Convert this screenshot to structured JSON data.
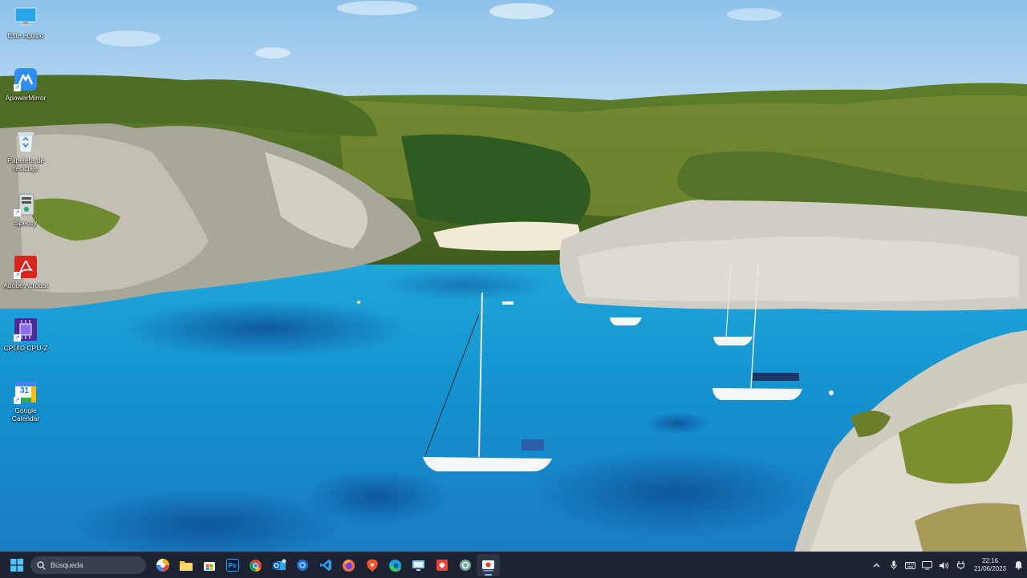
{
  "desktop": {
    "icons": [
      {
        "label": "Este equipo",
        "icon": "computer-icon"
      },
      {
        "label": "ApowerMirror",
        "icon": "apowermirror-icon"
      },
      {
        "label": "Papelera de reciclaje",
        "icon": "recycle-bin-icon"
      },
      {
        "label": "Speccy",
        "icon": "speccy-icon"
      },
      {
        "label": "Adobe Acrobat",
        "icon": "acrobat-icon"
      },
      {
        "label": "CPUID CPU-Z",
        "icon": "cpuz-icon"
      },
      {
        "label": "Google Calendar",
        "icon": "calendar-icon"
      }
    ],
    "calendar_day": "31"
  },
  "taskbar": {
    "search_placeholder": "Búsqueda",
    "pinned": [
      {
        "name": "ai-orb-icon"
      },
      {
        "name": "file-explorer-icon"
      },
      {
        "name": "store-icon"
      },
      {
        "name": "photoshop-icon",
        "text": "Ps"
      },
      {
        "name": "chrome-icon"
      },
      {
        "name": "outlook-icon"
      },
      {
        "name": "browser-globe-icon"
      },
      {
        "name": "vscode-icon"
      },
      {
        "name": "firefox-icon"
      },
      {
        "name": "brave-icon"
      },
      {
        "name": "edge-icon"
      },
      {
        "name": "remote-desktop-icon"
      },
      {
        "name": "anydesk-icon"
      },
      {
        "name": "chatgpt-icon"
      },
      {
        "name": "screen-recorder-icon"
      }
    ],
    "clock": {
      "time": "22:16",
      "date": "21/06/2023"
    }
  }
}
